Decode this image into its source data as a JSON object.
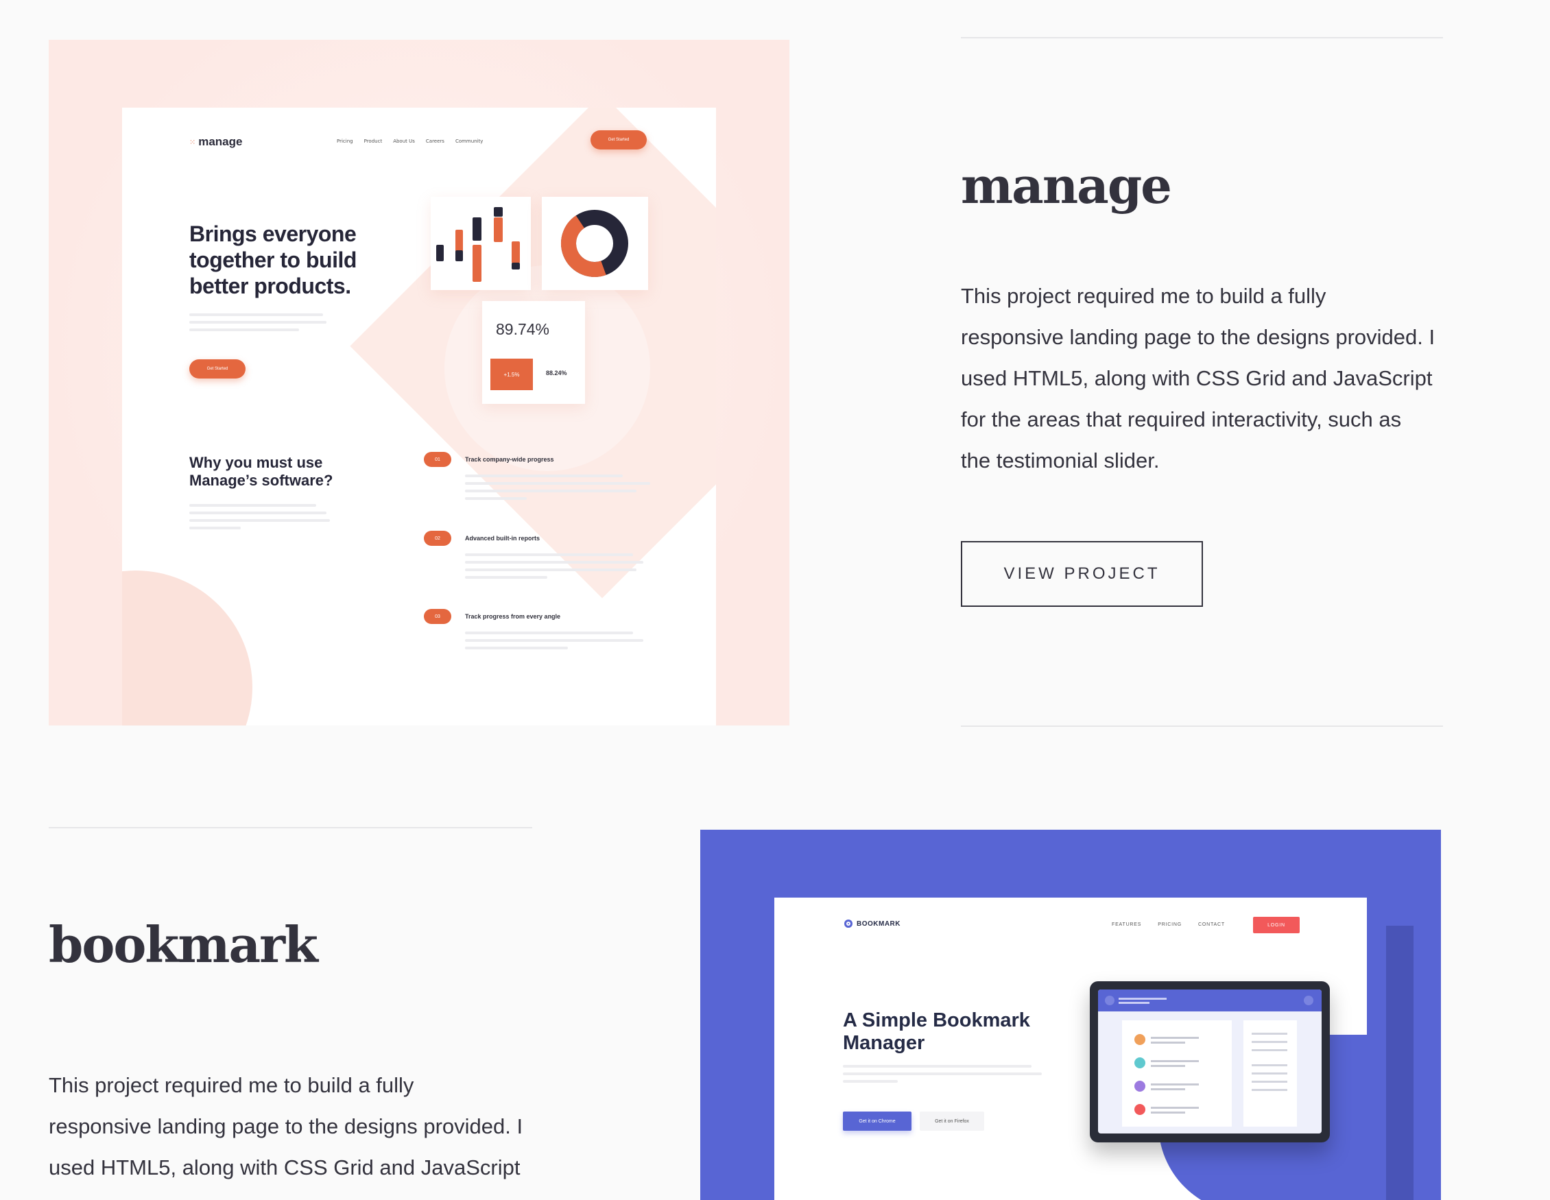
{
  "projects": [
    {
      "title": "manage",
      "description": "This project required me to build a fully responsive landing page to the designs provided. I used HTML5, along with CSS Grid and JavaScript for the areas that required interactivity, such as the testimonial slider.",
      "desc_lines": [
        "This project required me to build a fully",
        "responsive landing page to the designs provided. I",
        "used HTML5, along with CSS Grid and JavaScript",
        "for the areas that required interactivity, such as",
        "the testimonial slider."
      ],
      "button_label": "VIEW PROJECT",
      "preview": {
        "logo": "manage",
        "nav": [
          "Pricing",
          "Product",
          "About Us",
          "Careers",
          "Community"
        ],
        "cta": "Get Started",
        "headline_lines": [
          "Brings everyone",
          "together to build",
          "better products."
        ],
        "hero_button": "Get Started",
        "stat_main": "89.74%",
        "stat_change": "+1.5%",
        "stat_secondary": "88.24%",
        "why_lines": [
          "Why you must use",
          "Manage’s software?"
        ],
        "features": [
          {
            "num": "01",
            "title": "Track company-wide progress"
          },
          {
            "num": "02",
            "title": "Advanced built-in reports"
          },
          {
            "num": "03",
            "title": "Track progress from every angle"
          }
        ],
        "accent_color": "#e4673f",
        "bg_color": "#fde9e5"
      }
    },
    {
      "title": "bookmark",
      "desc_lines": [
        "This project required me to build a fully",
        "responsive landing page to the designs provided. I",
        "used HTML5, along with CSS Grid and JavaScript"
      ],
      "preview": {
        "logo": "BOOKMARK",
        "nav": [
          "FEATURES",
          "PRICING",
          "CONTACT"
        ],
        "login": "LOGIN",
        "headline_lines": [
          "A Simple Bookmark",
          "Manager"
        ],
        "btn_chrome": "Get it on Chrome",
        "btn_firefox": "Get it on Firefox",
        "accent_color": "#5865d4",
        "login_color": "#f2595a"
      }
    }
  ]
}
